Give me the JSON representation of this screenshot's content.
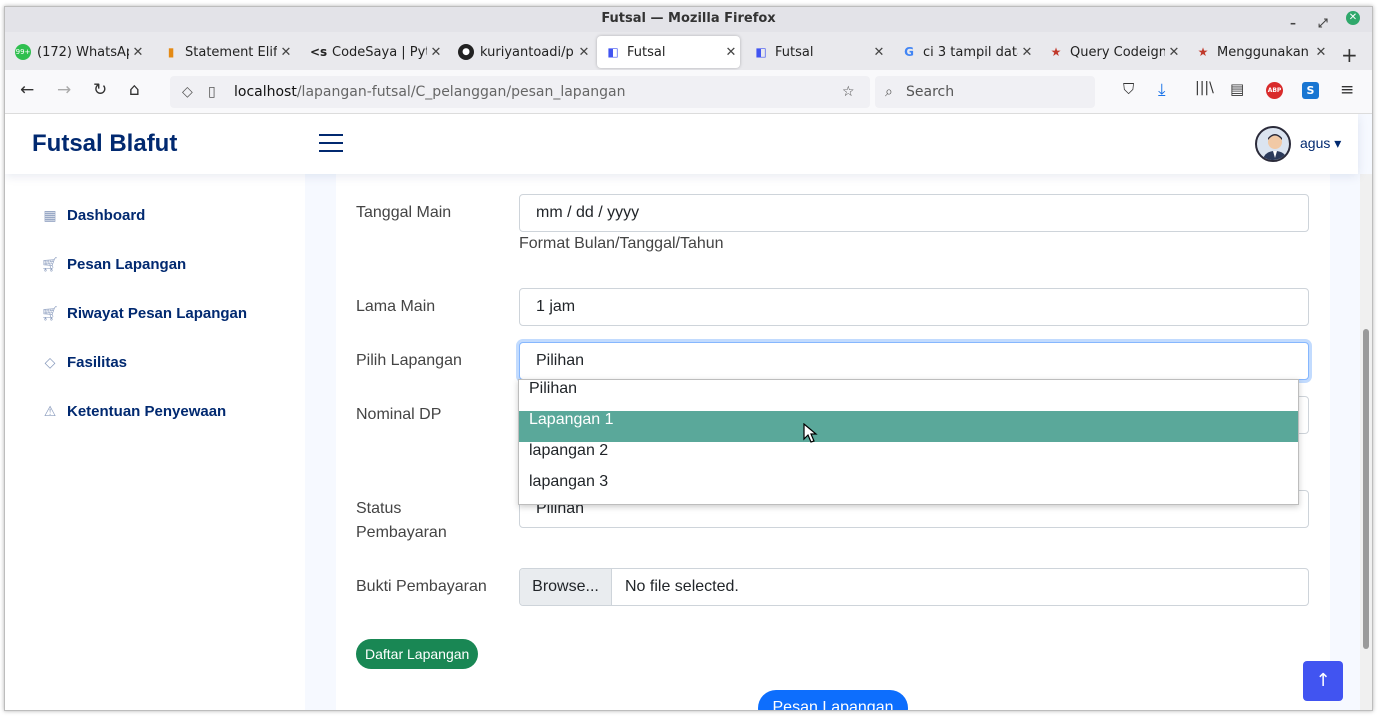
{
  "window": {
    "title": "Futsal — Mozilla Firefox"
  },
  "tabs": [
    {
      "label": "(172) WhatsAp",
      "icon": "whatsapp-icon"
    },
    {
      "label": "Statement Elif",
      "icon": "book-icon"
    },
    {
      "label": "CodeSaya | Pyt",
      "icon": "code-icon"
    },
    {
      "label": "kuriyantoadi/p",
      "icon": "github-icon"
    },
    {
      "label": "Futsal",
      "icon": "futsal-logo-icon",
      "active": true
    },
    {
      "label": "Futsal",
      "icon": "futsal-logo-icon"
    },
    {
      "label": "ci 3 tampil data",
      "icon": "google-icon"
    },
    {
      "label": "Query Codeign",
      "icon": "bookmark-icon"
    },
    {
      "label": "Menggunakan",
      "icon": "bookmark-icon"
    }
  ],
  "address": {
    "host": "localhost",
    "path": "/lapangan-futsal/C_pelanggan/pesan_lapangan"
  },
  "search": {
    "placeholder": "Search"
  },
  "app": {
    "brand": "Futsal Blafut",
    "user": "agus"
  },
  "sidebar": {
    "items": [
      {
        "label": "Dashboard",
        "icon": "grid-icon"
      },
      {
        "label": "Pesan Lapangan",
        "icon": "cart-icon"
      },
      {
        "label": "Riwayat Pesan Lapangan",
        "icon": "cart-icon"
      },
      {
        "label": "Fasilitas",
        "icon": "gem-icon"
      },
      {
        "label": "Ketentuan Penyewaan",
        "icon": "warning-icon"
      }
    ]
  },
  "form": {
    "tanggal_label": "Tanggal Main",
    "tanggal_value": "mm / dd / yyyy",
    "tanggal_help": "Format Bulan/Tanggal/Tahun",
    "lama_label": "Lama Main",
    "lama_value": "1 jam",
    "lapangan_label": "Pilih Lapangan",
    "lapangan_value": "Pilihan",
    "lapangan_options": [
      "Pilihan",
      "Lapangan 1",
      "lapangan 2",
      "lapangan 3"
    ],
    "nominal_label": "Nominal DP",
    "status_label_1": "Status",
    "status_label_2": "Pembayaran",
    "status_value": "Pilihan",
    "bukti_label": "Bukti Pembayaran",
    "bukti_button": "Browse...",
    "bukti_value": "No file selected.",
    "daftar_button": "Daftar Lapangan",
    "submit_button": "Pesan Lapangan"
  },
  "colors": {
    "brand": "#012970",
    "option_highlight": "#5aa89a",
    "primary": "#0d6efd",
    "success": "#198754"
  }
}
